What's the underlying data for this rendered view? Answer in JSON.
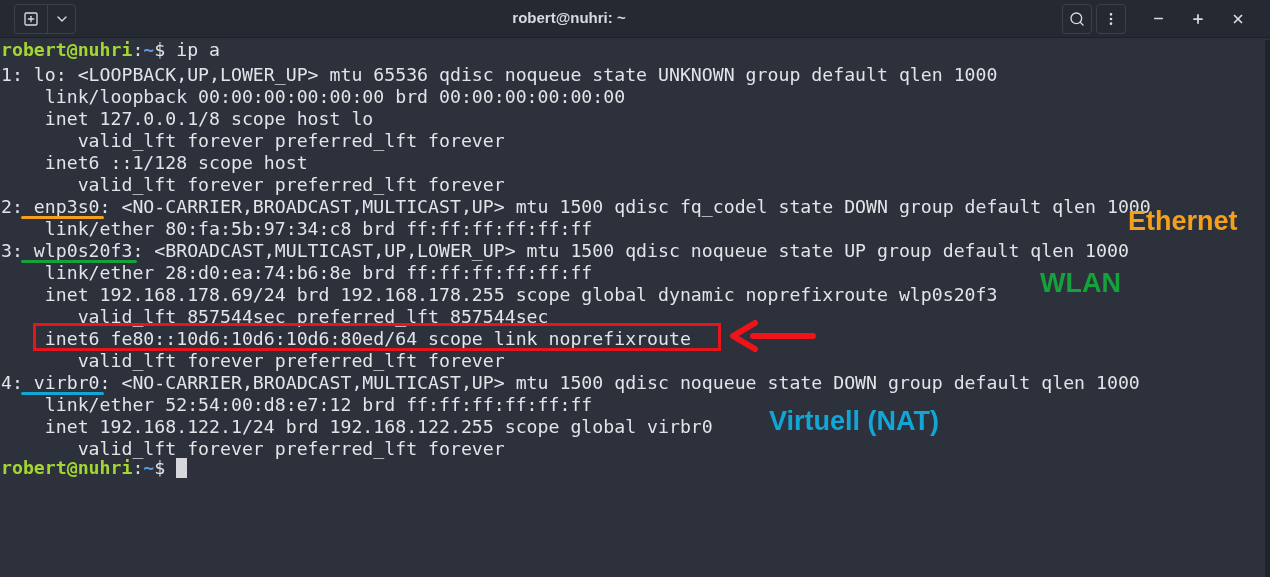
{
  "window": {
    "title": "robert@nuhri: ~"
  },
  "terminal": {
    "lines": [
      {
        "kind": "prompt",
        "user": "robert@nuhri",
        "separator": ":",
        "path": "~",
        "symbol": "$",
        "command": " ip a"
      },
      {
        "kind": "interface",
        "index": "1:",
        "name": " lo:",
        "rest": " <LOOPBACK,UP,LOWER_UP> mtu 65536 qdisc noqueue state UNKNOWN group default qlen 1000"
      },
      {
        "kind": "address",
        "text": "link/loopback 00:00:00:00:00:00 brd 00:00:00:00:00:00",
        "boxed": false
      },
      {
        "kind": "address",
        "text": "inet 127.0.0.1/8 scope host lo",
        "boxed": false
      },
      {
        "kind": "lifetime",
        "text": "valid_lft forever preferred_lft forever"
      },
      {
        "kind": "address",
        "text": "inet6 ::1/128 scope host",
        "boxed": false
      },
      {
        "kind": "lifetime",
        "text": "valid_lft forever preferred_lft forever"
      },
      {
        "kind": "interface",
        "index": "2:",
        "name": " enp3s0:",
        "rest": " <NO-CARRIER,BROADCAST,MULTICAST,UP> mtu 1500 qdisc fq_codel state DOWN group default qlen 1000",
        "color": "#f5a01a"
      },
      {
        "kind": "address",
        "text": "link/ether 80:fa:5b:97:34:c8 brd ff:ff:ff:ff:ff:ff",
        "boxed": false
      },
      {
        "kind": "interface",
        "index": "3:",
        "name": " wlp0s20f3:",
        "rest": " <BROADCAST,MULTICAST,UP,LOWER_UP> mtu 1500 qdisc noqueue state UP group default qlen 1000",
        "color": "#16a23a"
      },
      {
        "kind": "address",
        "text": "link/ether 28:d0:ea:74:b6:8e brd ff:ff:ff:ff:ff:ff",
        "boxed": false
      },
      {
        "kind": "address",
        "text": "inet 192.168.178.69/24 brd 192.168.178.255 scope global dynamic noprefixroute wlp0s20f3",
        "boxed": false
      },
      {
        "kind": "lifetime",
        "text": "valid_lft 857544sec preferred_lft 857544sec"
      },
      {
        "kind": "address",
        "text": "inet6 fe80::10d6:10d6:10d6:80ed/64 scope link noprefixroute",
        "boxed": true
      },
      {
        "kind": "lifetime",
        "text": "valid_lft forever preferred_lft forever"
      },
      {
        "kind": "interface",
        "index": "4:",
        "name": " virbr0:",
        "rest": " <NO-CARRIER,BROADCAST,MULTICAST,UP> mtu 1500 qdisc noqueue state DOWN group default qlen 1000",
        "color": "#12a6d6"
      },
      {
        "kind": "address",
        "text": "link/ether 52:54:00:d8:e7:12 brd ff:ff:ff:ff:ff:ff",
        "boxed": false
      },
      {
        "kind": "address",
        "text": "inet 192.168.122.1/24 brd 192.168.122.255 scope global virbr0",
        "boxed": false
      },
      {
        "kind": "lifetime",
        "text": "valid_lft forever preferred_lft forever"
      },
      {
        "kind": "prompt",
        "user": "robert@nuhri",
        "separator": ":",
        "path": "~",
        "symbol": "$",
        "cursor": true
      }
    ]
  },
  "annotations": [
    {
      "text": "Ethernet",
      "color": "#f5a01a"
    },
    {
      "text": "WLAN",
      "color": "#16a23a"
    },
    {
      "text": "Virtuell (NAT)",
      "color": "#12a6d6"
    }
  ]
}
